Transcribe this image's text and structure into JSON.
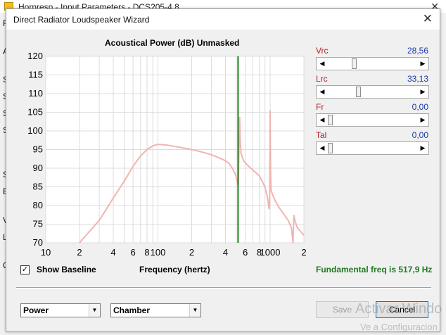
{
  "background_window": {
    "title": "Hornresp - Input Parameters - DCS205-4 8",
    "close_glyph": "✕",
    "side_letters": [
      "F",
      "A",
      "S",
      "S",
      "S",
      "S",
      "S",
      "E",
      "V",
      "L",
      "C"
    ]
  },
  "dialog": {
    "title": "Direct Radiator Loudspeaker Wizard",
    "close_glyph": "✕"
  },
  "chart": {
    "title": "Acoustical Power (dB)   Unmasked"
  },
  "chart_data": {
    "type": "line",
    "title": "Acoustical Power (dB)   Unmasked",
    "xlabel": "Frequency (hertz)",
    "ylabel": "",
    "x_scale": "log",
    "xlim": [
      10,
      2000
    ],
    "ylim": [
      70,
      120
    ],
    "y_ticks": [
      70,
      75,
      80,
      85,
      90,
      95,
      100,
      105,
      110,
      115,
      120
    ],
    "x_tick_labels": [
      {
        "x": 10,
        "label": "10"
      },
      {
        "x": 20,
        "label": "2"
      },
      {
        "x": 40,
        "label": "4"
      },
      {
        "x": 60,
        "label": "6"
      },
      {
        "x": 80,
        "label": "8"
      },
      {
        "x": 100,
        "label": "100"
      },
      {
        "x": 200,
        "label": "2"
      },
      {
        "x": 400,
        "label": "4"
      },
      {
        "x": 600,
        "label": "6"
      },
      {
        "x": 800,
        "label": "8"
      },
      {
        "x": 1000,
        "label": "1000"
      },
      {
        "x": 2000,
        "label": "2"
      }
    ],
    "grid": true,
    "marker_line": {
      "x": 517.9,
      "color": "#1a7f1a"
    },
    "series": [
      {
        "color": "#f0b4b0",
        "points": [
          [
            20,
            70
          ],
          [
            30,
            76
          ],
          [
            40,
            82
          ],
          [
            50,
            86.5
          ],
          [
            60,
            90.5
          ],
          [
            70,
            93.3
          ],
          [
            80,
            95
          ],
          [
            90,
            96
          ],
          [
            100,
            96.4
          ],
          [
            120,
            96.2
          ],
          [
            150,
            95.7
          ],
          [
            200,
            95
          ],
          [
            250,
            94.3
          ],
          [
            300,
            93.6
          ],
          [
            350,
            92.8
          ],
          [
            400,
            92
          ],
          [
            430,
            91.3
          ],
          [
            460,
            90
          ],
          [
            490,
            88.4
          ],
          [
            510,
            86.5
          ],
          [
            520,
            85
          ],
          [
            530,
            98
          ],
          [
            535,
            103.8
          ],
          [
            540,
            98
          ],
          [
            550,
            94
          ],
          [
            580,
            92
          ],
          [
            620,
            91
          ],
          [
            700,
            89.5
          ],
          [
            800,
            88
          ],
          [
            900,
            85
          ],
          [
            950,
            82
          ],
          [
            980,
            79
          ],
          [
            990,
            80
          ],
          [
            1000,
            105.5
          ],
          [
            1010,
            88
          ],
          [
            1020,
            84
          ],
          [
            1050,
            83
          ],
          [
            1100,
            81.5
          ],
          [
            1200,
            79.5
          ],
          [
            1300,
            78
          ],
          [
            1450,
            76
          ],
          [
            1550,
            74
          ],
          [
            1600,
            70
          ],
          [
            1630,
            77.5
          ],
          [
            1660,
            76
          ],
          [
            1750,
            74
          ],
          [
            2000,
            72
          ]
        ]
      }
    ]
  },
  "params": [
    {
      "label": "Vrc",
      "value": "28,56",
      "position": 0.28
    },
    {
      "label": "Lrc",
      "value": "33,13",
      "position": 0.33
    },
    {
      "label": "Fr",
      "value": "0,00",
      "position": 0.0
    },
    {
      "label": "Tal",
      "value": "0,00",
      "position": 0.0
    }
  ],
  "baseline": {
    "check": "✓",
    "label": "Show Baseline",
    "checked": true
  },
  "frequency_label": "Frequency (hertz)",
  "fundamental": "Fundamental freq is 517,9 Hz",
  "dropdowns": {
    "type": {
      "value": "Power"
    },
    "environment": {
      "value": "Chamber"
    }
  },
  "buttons": {
    "save": "Save",
    "cancel": "Cancel"
  },
  "watermark": {
    "line1": "Activar Windo",
    "line2": "Ve a Configuracion"
  },
  "colors": {
    "curve": "#f0b4b0",
    "marker": "#1a7f1a",
    "param_label": "#b22222",
    "param_value": "#1a3aa8",
    "fundamental": "#1f7a1f"
  }
}
